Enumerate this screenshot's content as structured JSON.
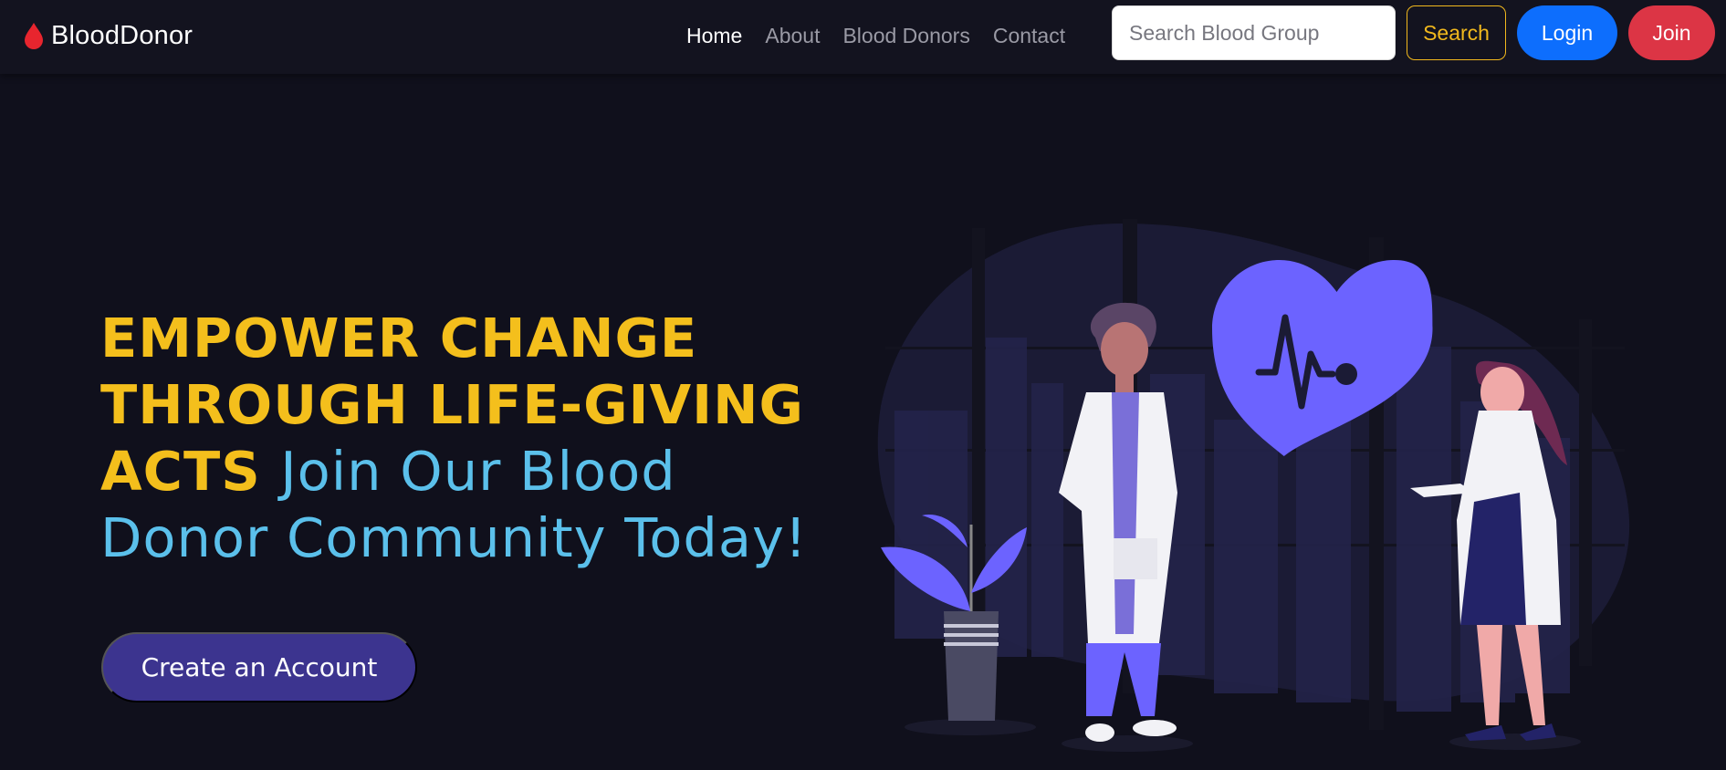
{
  "brand": {
    "name": "BloodDonor",
    "icon": "blood-drop-icon",
    "icon_color": "#e8252e"
  },
  "nav": {
    "links": [
      {
        "label": "Home",
        "active": true
      },
      {
        "label": "About",
        "active": false
      },
      {
        "label": "Blood Donors",
        "active": false
      },
      {
        "label": "Contact",
        "active": false
      }
    ]
  },
  "search": {
    "placeholder": "Search Blood Group",
    "value": "",
    "button_label": "Search"
  },
  "auth": {
    "login_label": "Login",
    "join_label": "Join"
  },
  "hero": {
    "heading_line1": "EMPOWER CHANGE",
    "heading_line2": "THROUGH LIFE-GIVING",
    "heading_line3_strong": "ACTS",
    "heading_line3_soft": "Join Our Blood",
    "heading_line4": "Donor Community Today!",
    "cta_label": "Create an Account"
  },
  "illustration": {
    "icon": "doctors-heartbeat-illustration"
  },
  "colors": {
    "background": "#10101c",
    "navbar": "#13131f",
    "accent_yellow": "#f4bf1c",
    "accent_blue": "#5bc0eb",
    "login": "#0d6efd",
    "join": "#dc3545",
    "cta": "#3c348f",
    "illustration_purple": "#6c63ff"
  }
}
